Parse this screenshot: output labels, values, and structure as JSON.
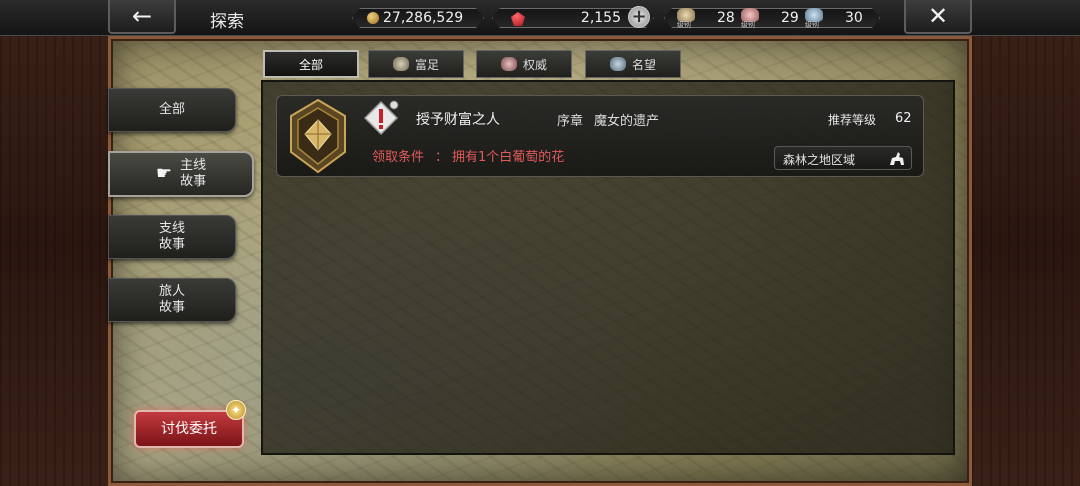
{
  "header": {
    "title": "探索",
    "back_icon": "←",
    "close_icon": "✕",
    "gold": "27,286,529",
    "gems": "2,155",
    "plus": "+",
    "ranks": [
      {
        "label": "级别",
        "value": "28",
        "color": "#c9b48a"
      },
      {
        "label": "级别",
        "value": "29",
        "color": "#d99a9a"
      },
      {
        "label": "级别",
        "value": "30",
        "color": "#8fb0c8"
      }
    ]
  },
  "tabs": [
    {
      "label": "全部",
      "icon": "",
      "active": true
    },
    {
      "label": "富足",
      "icon": "wealth-icon",
      "active": false
    },
    {
      "label": "权威",
      "icon": "authority-icon",
      "active": false
    },
    {
      "label": "名望",
      "icon": "fame-icon",
      "active": false
    }
  ],
  "sidebar": {
    "items": [
      {
        "label": "全部",
        "active": false
      },
      {
        "label": "主线\n故事",
        "active": true
      },
      {
        "label": "支线\n故事",
        "active": false
      },
      {
        "label": "旅人\n故事",
        "active": false
      }
    ],
    "commission_label": "讨伐委托",
    "commission_badge": "✦"
  },
  "quest": {
    "title": "授予财富之人",
    "chapter": "序章",
    "chapter_name": "魔女的遗产",
    "recommended_label": "推荐等级",
    "recommended_level": "62",
    "requirement_label": "领取条件",
    "requirement_sep": "：",
    "requirement_value": "拥有1个白葡萄的花",
    "region": "森林之地区域"
  },
  "colors": {
    "accent_red": "#e05a5a",
    "commission": "#c23a3e",
    "frame": "#8b5a3a"
  }
}
